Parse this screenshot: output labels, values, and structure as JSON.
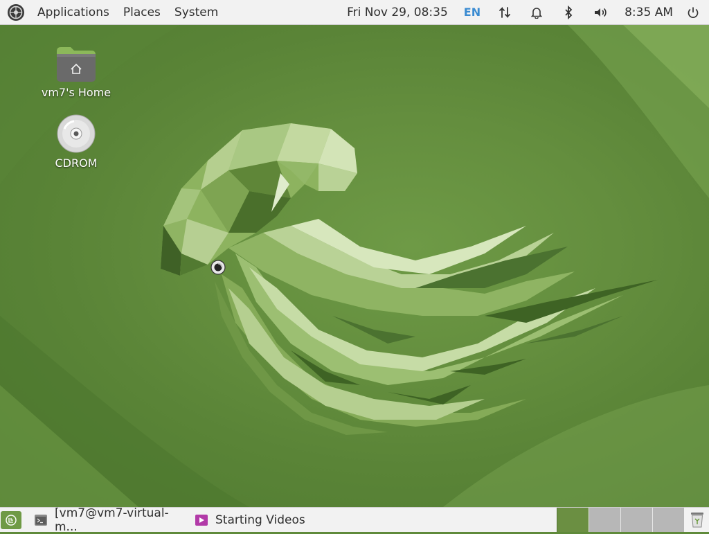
{
  "top_panel": {
    "menus": [
      "Applications",
      "Places",
      "System"
    ],
    "date": "Fri Nov 29, 08:35",
    "keyboard_layout": "EN",
    "time": "8:35 AM",
    "tray_icons": [
      "network-icon",
      "notifications-bell-icon",
      "bluetooth-icon",
      "volume-icon",
      "power-icon"
    ]
  },
  "desktop": {
    "icons": [
      {
        "label": "vm7's Home",
        "icon": "home-folder-icon"
      },
      {
        "label": "CDROM",
        "icon": "optical-disc-icon"
      }
    ]
  },
  "bottom_panel": {
    "tasks": [
      {
        "label": "[vm7@vm7-virtual-m...",
        "icon": "terminal-icon"
      },
      {
        "label": "Starting Videos",
        "icon": "videos-app-icon"
      }
    ],
    "workspaces": {
      "count": 4,
      "active": 1
    },
    "trash_icon": "trash-icon"
  },
  "colors": {
    "wallpaper_green": "#5f8a3a",
    "panel_bg": "#f2f2f2",
    "accent_blue": "#3a8bd1"
  }
}
